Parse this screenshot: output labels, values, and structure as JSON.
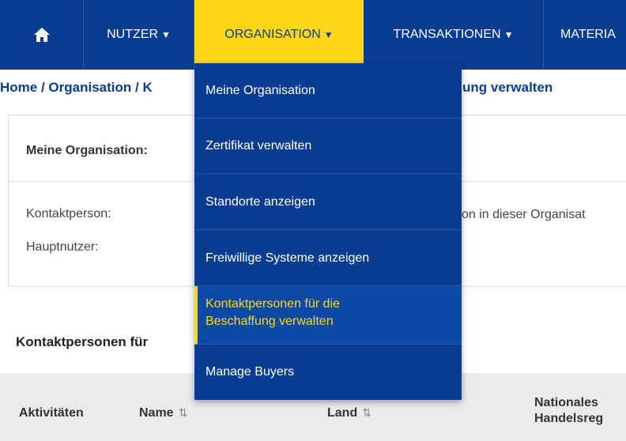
{
  "nav": {
    "home_icon": "home-icon",
    "items": [
      {
        "label": "NUTZER"
      },
      {
        "label": "ORGANISATION"
      },
      {
        "label": "TRANSAKTIONEN"
      },
      {
        "label": "MATERIA"
      }
    ],
    "caret": "▼",
    "active_color": "#ffd617",
    "bar_color": "#0a3d91"
  },
  "breadcrumb": {
    "home": "Home",
    "sep1": " / ",
    "org": "Organisation",
    "sep2": " / ",
    "current_start": "K",
    "current_end": "ung verwalten"
  },
  "panel": {
    "title": "Meine Organisation: ",
    "contact_label": "Kontaktperson:",
    "main_user_label": "Hauptnutzer:",
    "contact_text": "on in dieser Organisat"
  },
  "section_title": "Kontaktpersonen für",
  "table": {
    "col1": "Aktivitäten",
    "col2": "Name",
    "col3": "Land",
    "col4_line1": "Nationales",
    "col4_line2": "Handelsreg",
    "sort_icon": "⇅"
  },
  "dropdown": {
    "items": [
      {
        "label": "Meine Organisation"
      },
      {
        "label": "Zertifikat verwalten"
      },
      {
        "label": "Standorte anzeigen"
      },
      {
        "label": "Freiwillige Systeme anzeigen"
      },
      {
        "label_line1": "Kontaktpersonen für die",
        "label_line2": "Beschaffung verwalten"
      },
      {
        "label": "Manage Buyers"
      }
    ]
  }
}
